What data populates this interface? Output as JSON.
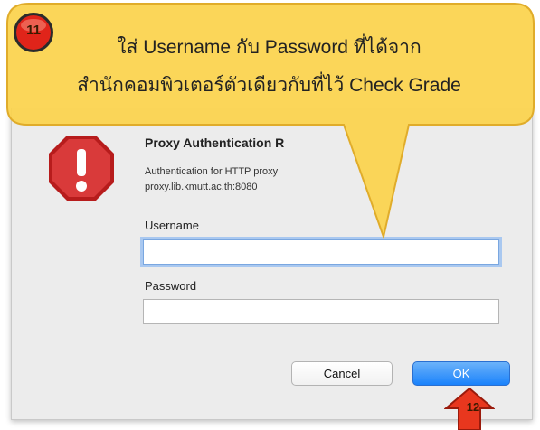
{
  "callout": {
    "step_number": "11",
    "line1": "ใส่ Username กับ Password ที่ได้จาก",
    "line2": "สำนักคอมพิวเตอร์ตัวเดียวกับที่ไว้ Check Grade",
    "fill_color": "#fbd34c"
  },
  "dialog": {
    "title": "Proxy Authentication R",
    "message_line1": "Authentication for HTTP proxy",
    "message_line2": "proxy.lib.kmutt.ac.th:8080",
    "icon": "stop-alert-icon",
    "username_label": "Username",
    "username_value": "",
    "password_label": "Password",
    "password_value": "",
    "cancel_label": "Cancel",
    "ok_label": "OK",
    "accent_color": "#1a82fb",
    "alert_color": "#cc1f1f"
  },
  "pointer": {
    "step_number": "12",
    "icon": "up-arrow-icon",
    "color": "#e8371e"
  }
}
